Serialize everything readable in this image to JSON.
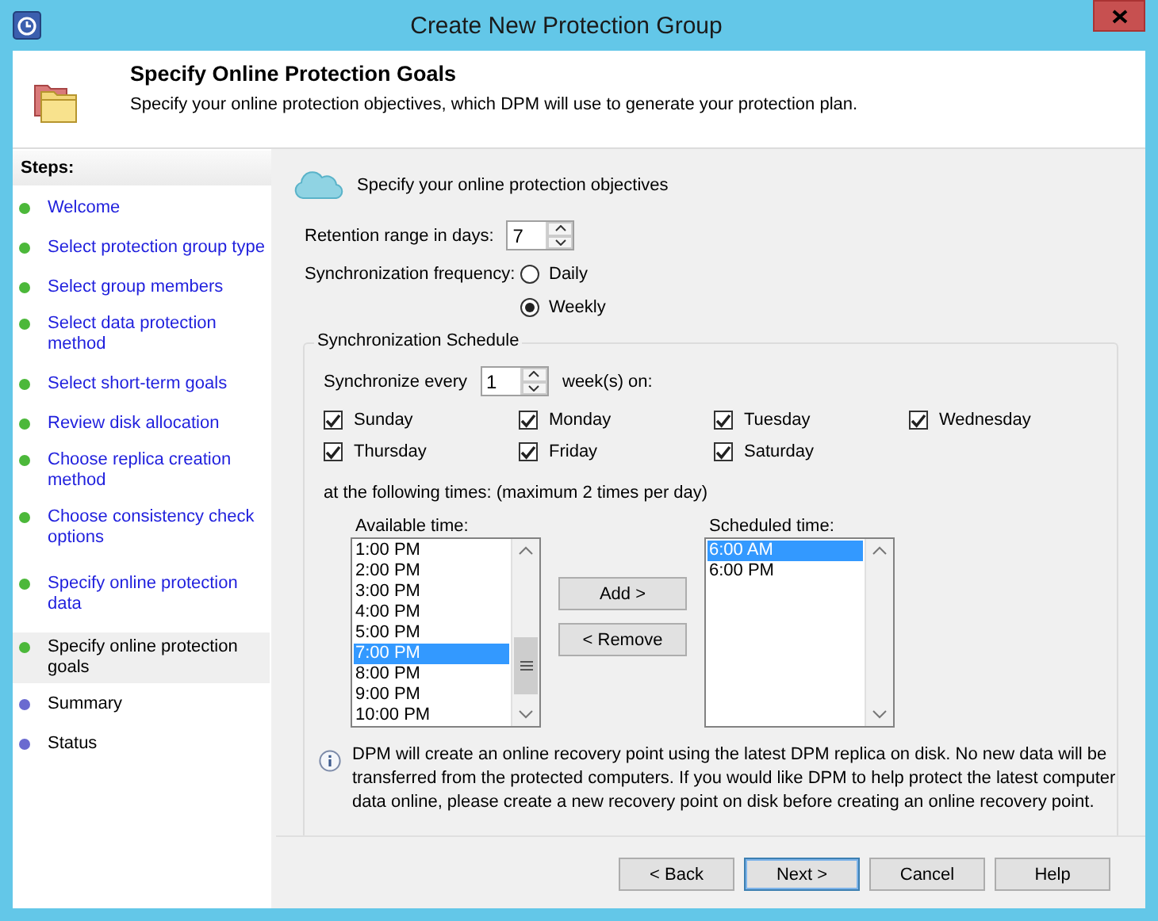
{
  "window": {
    "title": "Create New Protection Group"
  },
  "header": {
    "title": "Specify Online Protection Goals",
    "subtitle": "Specify your online protection objectives, which DPM will use to generate your protection plan."
  },
  "steps": {
    "heading": "Steps:",
    "items": [
      {
        "label": "Welcome",
        "color": "#4cb83a",
        "link": true,
        "selected": false
      },
      {
        "label": "Select protection group type",
        "color": "#4cb83a",
        "link": true,
        "selected": false
      },
      {
        "label": "Select group members",
        "color": "#4cb83a",
        "link": true,
        "selected": false
      },
      {
        "label": "Select data protection method",
        "color": "#4cb83a",
        "link": true,
        "selected": false
      },
      {
        "label": "Select short-term goals",
        "color": "#4cb83a",
        "link": true,
        "selected": false
      },
      {
        "label": "Review disk allocation",
        "color": "#4cb83a",
        "link": true,
        "selected": false
      },
      {
        "label": "Choose replica creation method",
        "color": "#4cb83a",
        "link": true,
        "selected": false
      },
      {
        "label": "Choose consistency check options",
        "color": "#4cb83a",
        "link": true,
        "selected": false
      },
      {
        "label": "Specify online protection data",
        "color": "#4cb83a",
        "link": true,
        "selected": false
      },
      {
        "label": "Specify online protection goals",
        "color": "#4cb83a",
        "link": false,
        "selected": true
      },
      {
        "label": "Summary",
        "color": "#6a6ad0",
        "link": false,
        "selected": false
      },
      {
        "label": "Status",
        "color": "#6a6ad0",
        "link": false,
        "selected": false
      }
    ]
  },
  "section": {
    "title": "Specify your online protection objectives"
  },
  "retention": {
    "label": "Retention range in days:",
    "value": "7"
  },
  "frequency": {
    "label": "Synchronization frequency:",
    "options": [
      {
        "label": "Daily",
        "selected": false
      },
      {
        "label": "Weekly",
        "selected": true
      }
    ]
  },
  "schedule": {
    "legend": "Synchronization Schedule",
    "every_label": "Synchronize every",
    "every_value": "1",
    "every_suffix": "week(s) on:",
    "days": [
      {
        "label": "Sunday",
        "checked": true
      },
      {
        "label": "Monday",
        "checked": true
      },
      {
        "label": "Tuesday",
        "checked": true
      },
      {
        "label": "Wednesday",
        "checked": true
      },
      {
        "label": "Thursday",
        "checked": true
      },
      {
        "label": "Friday",
        "checked": true
      },
      {
        "label": "Saturday",
        "checked": true
      }
    ],
    "times_note": "at the following times: (maximum 2 times per day)",
    "available": {
      "label": "Available time:",
      "items": [
        {
          "label": "1:00 PM",
          "selected": false
        },
        {
          "label": "2:00 PM",
          "selected": false
        },
        {
          "label": "3:00 PM",
          "selected": false
        },
        {
          "label": "4:00 PM",
          "selected": false
        },
        {
          "label": "5:00 PM",
          "selected": false
        },
        {
          "label": "7:00 PM",
          "selected": true
        },
        {
          "label": "8:00 PM",
          "selected": false
        },
        {
          "label": "9:00 PM",
          "selected": false
        },
        {
          "label": "10:00 PM",
          "selected": false
        }
      ]
    },
    "add_button": "Add >",
    "remove_button": "< Remove",
    "scheduled": {
      "label": "Scheduled time:",
      "items": [
        {
          "label": "6:00 AM",
          "selected": true
        },
        {
          "label": "6:00 PM",
          "selected": false
        }
      ]
    }
  },
  "info": "DPM will create an online recovery point using the latest DPM replica on disk. No new data will be transferred from the protected computers. If you would like DPM to help protect the latest computer data online, please create a new recovery point on disk before creating an online recovery point.",
  "buttons": [
    {
      "label": "< Back",
      "default": false
    },
    {
      "label": "Next >",
      "default": true
    },
    {
      "label": "Cancel",
      "default": false
    },
    {
      "label": "Help",
      "default": false
    }
  ]
}
